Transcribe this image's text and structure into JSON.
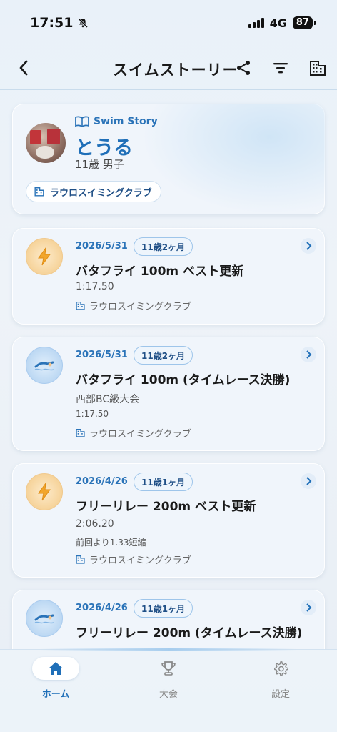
{
  "status": {
    "time": "17:51",
    "network": "4G",
    "battery": "87"
  },
  "header": {
    "title": "スイムストーリー"
  },
  "profile": {
    "story_label": "Swim Story",
    "name": "とうる",
    "sub": "11歳 男子",
    "club": "ラウロスイミングクラブ"
  },
  "events": [
    {
      "type": "best",
      "date": "2026/5/31",
      "age": "11歳2ヶ月",
      "title": "バタフライ 100m ベスト更新",
      "lines": [
        "1:17.50"
      ],
      "club": "ラウロスイミングクラブ"
    },
    {
      "type": "race",
      "date": "2026/5/31",
      "age": "11歳2ヶ月",
      "title": "バタフライ 100m (タイムレース決勝)",
      "lines": [
        "西部BC級大会",
        "1:17.50"
      ],
      "club": "ラウロスイミングクラブ"
    },
    {
      "type": "best",
      "date": "2026/4/26",
      "age": "11歳1ヶ月",
      "title": "フリーリレー 200m ベスト更新",
      "lines": [
        "2:06.20",
        "前回より1.33短縮"
      ],
      "club": "ラウロスイミングクラブ"
    },
    {
      "type": "race",
      "date": "2026/4/26",
      "age": "11歳1ヶ月",
      "title": "フリーリレー 200m (タイムレース決勝)",
      "lines": [],
      "club": ""
    }
  ],
  "nav": [
    {
      "label": "ホーム",
      "icon": "home-icon",
      "active": true
    },
    {
      "label": "大会",
      "icon": "trophy-icon",
      "active": false
    },
    {
      "label": "設定",
      "icon": "gear-icon",
      "active": false
    }
  ],
  "colors": {
    "accent": "#1f6fb8",
    "best_icon_bg": "#f6d39a",
    "race_icon_bg": "#bcd8f3"
  }
}
